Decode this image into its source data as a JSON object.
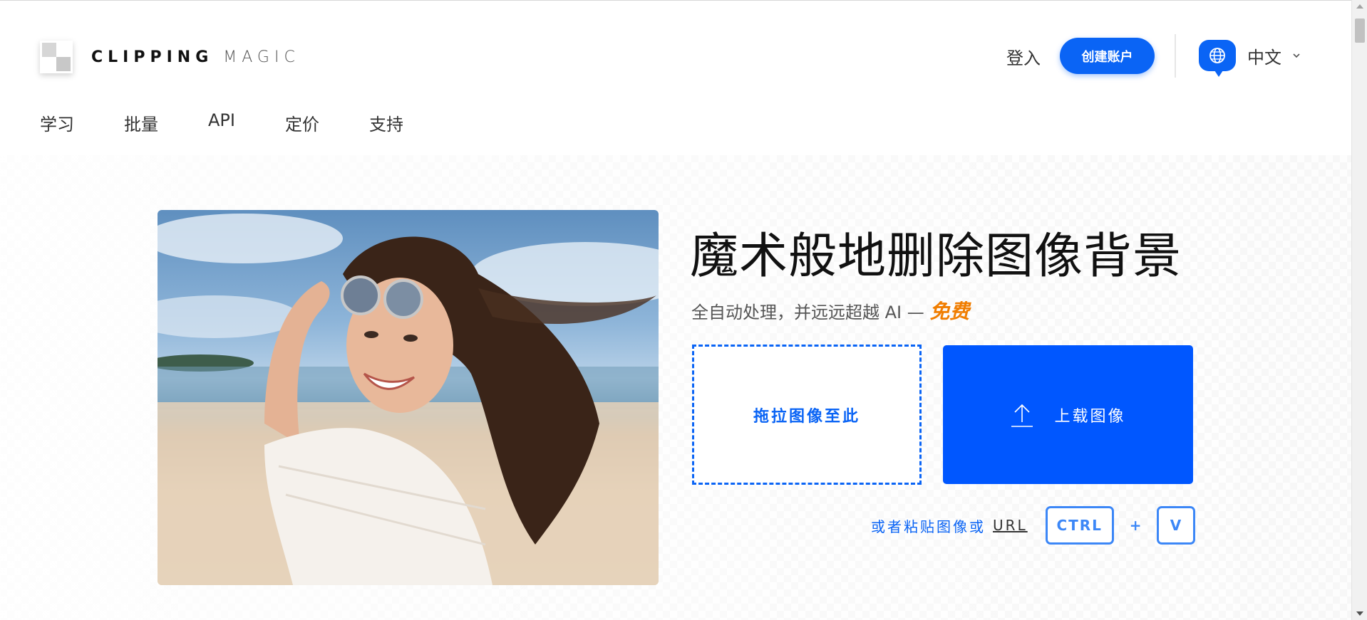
{
  "header": {
    "logo_bold": "CLIPPING",
    "logo_light": "MAGIC",
    "login_label": "登入",
    "signup_label": "创建账户",
    "language_label": "中文"
  },
  "nav": {
    "items": [
      "学习",
      "批量",
      "API",
      "定价",
      "支持"
    ]
  },
  "hero": {
    "title": "魔术般地删除图像背景",
    "subtitle": "全自动处理，并远远超越 AI —",
    "subtitle_highlight": "免费",
    "drop_label": "拖拉图像至此",
    "upload_label": "上载图像",
    "paste_text": "或者粘贴图像或",
    "paste_url": "URL",
    "key_ctrl": "CTRL",
    "key_plus": "+",
    "key_v": "V"
  },
  "colors": {
    "accent": "#0a64f5",
    "upload_button": "#0057ff",
    "highlight": "#f07d00"
  },
  "icons": {
    "globe": "globe-icon",
    "chevron": "chevron-down-icon",
    "upload": "upload-arrow-icon"
  }
}
